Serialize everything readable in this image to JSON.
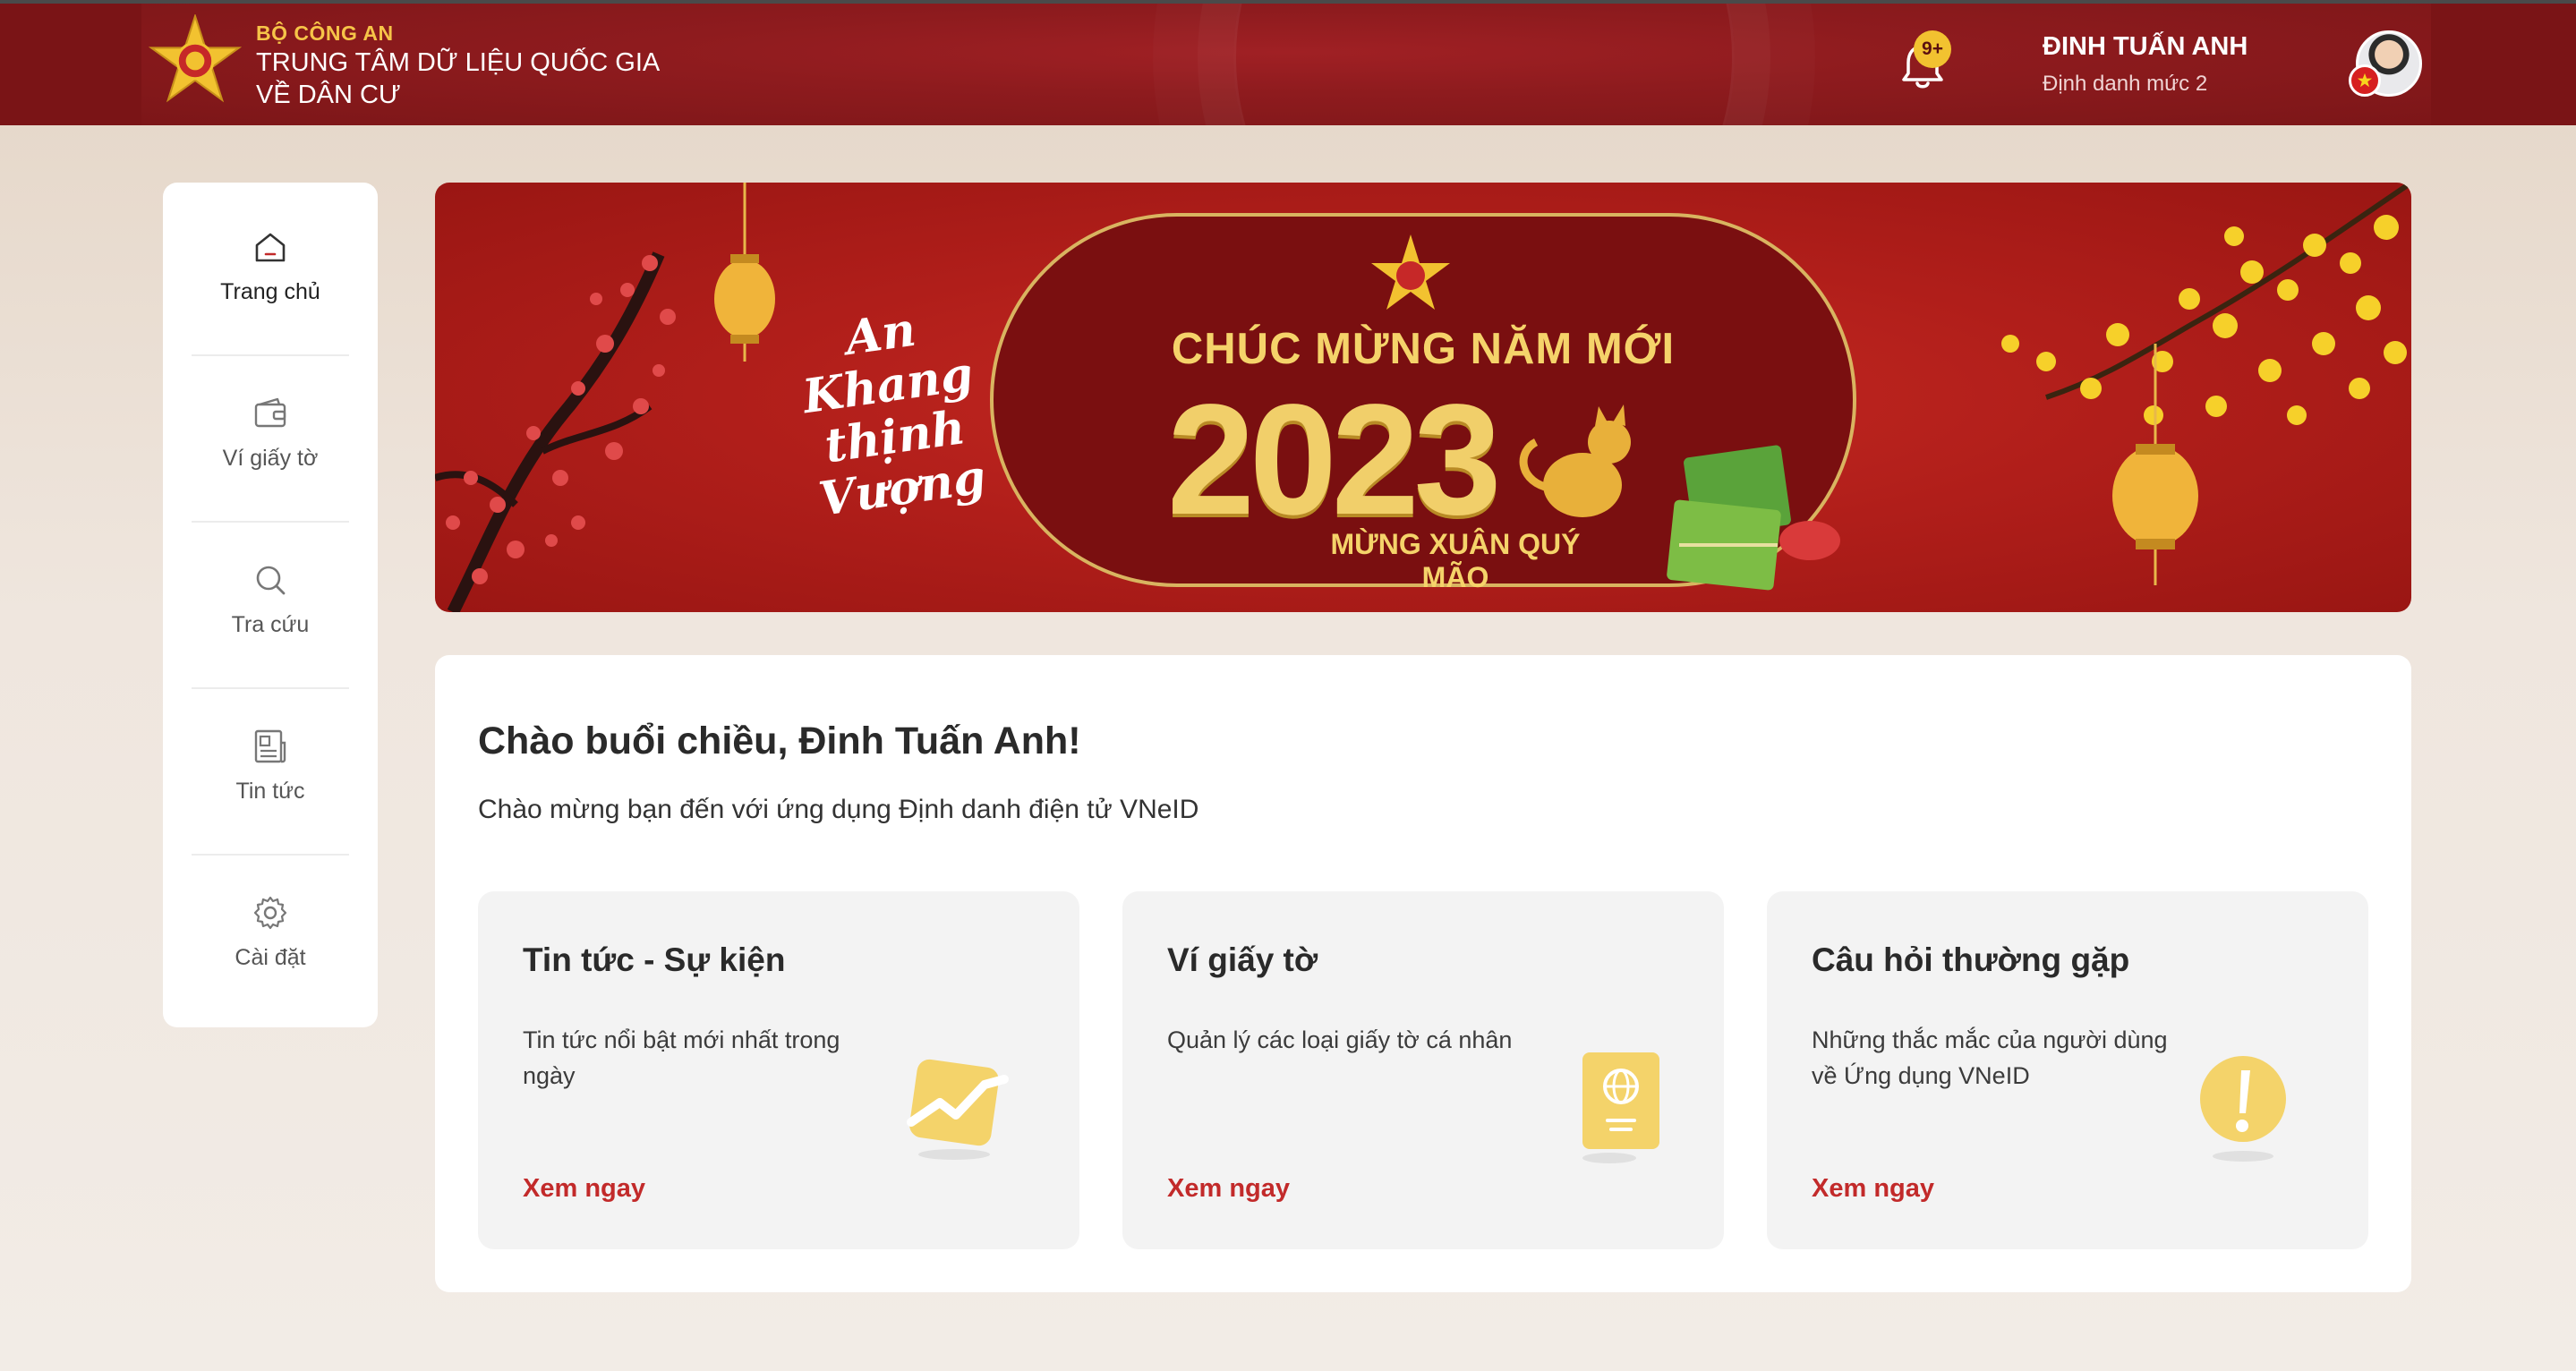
{
  "header": {
    "org_small": "BỘ CÔNG AN",
    "org_line1": "TRUNG TÂM DỮ LIỆU QUỐC GIA",
    "org_line2": "VỀ DÂN CƯ",
    "notification_badge": "9+",
    "user_name": "ĐINH TUẤN ANH",
    "user_level": "Định danh mức 2"
  },
  "sidebar": {
    "items": [
      {
        "label": "Trang chủ",
        "icon": "home-icon"
      },
      {
        "label": "Ví giấy tờ",
        "icon": "wallet-icon"
      },
      {
        "label": "Tra cứu",
        "icon": "search-icon"
      },
      {
        "label": "Tin tức",
        "icon": "newspaper-icon"
      },
      {
        "label": "Cài đặt",
        "icon": "gear-icon"
      }
    ]
  },
  "banner": {
    "script_text": "An Khang thịnh Vượng",
    "title": "CHÚC MỪNG NĂM MỚI",
    "year": "2023",
    "subtitle": "MỪNG XUÂN QUÝ MÃO"
  },
  "main": {
    "greeting": "Chào buổi chiều, Đinh Tuấn Anh!",
    "welcome": "Chào mừng bạn đến với ứng dụng Định danh điện tử VNeID",
    "cards": [
      {
        "title": "Tin tức - Sự kiện",
        "desc": "Tin tức nổi bật mới nhất trong ngày",
        "link": "Xem ngay",
        "icon": "trend-chart-icon"
      },
      {
        "title": "Ví giấy tờ",
        "desc": "Quản lý các loại giấy tờ cá nhân",
        "link": "Xem ngay",
        "icon": "passport-icon"
      },
      {
        "title": "Câu hỏi thường gặp",
        "desc": "Những thắc mắc của người dùng về Ứng dụng VNeID",
        "link": "Xem ngay",
        "icon": "exclamation-icon"
      }
    ]
  },
  "colors": {
    "header_red": "#7a1416",
    "accent_gold": "#f6c448",
    "link_red": "#c22a2a"
  }
}
